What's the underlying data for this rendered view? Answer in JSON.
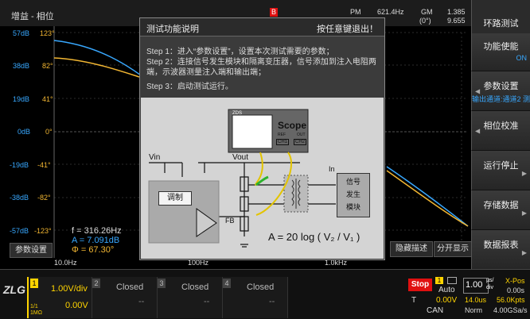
{
  "top_bar": {
    "y_label": "增益 - 相位",
    "marker": "B",
    "pm_label": "PM",
    "pm_freq": "621.4Hz",
    "gm_label": "GM",
    "gm_phase": "(0°)",
    "right_val_top": "1.385",
    "right_val_bot": "9.655",
    "title": "环路测试"
  },
  "y_axis": {
    "gain": [
      "57dB",
      "38dB",
      "19dB",
      "0dB",
      "-19dB",
      "-38dB",
      "-57dB"
    ],
    "phase": [
      "123°",
      "82°",
      "41°",
      "0°",
      "-41°",
      "-82°",
      "-123°"
    ]
  },
  "x_axis": [
    "10.0Hz",
    "100Hz",
    "1.0kHz"
  ],
  "readout": {
    "f": "f = 316.26Hz",
    "a": "A = 7.091dB",
    "phi": "Φ = 67.30°"
  },
  "param_btn": "参数设置",
  "hide_btn": "隐藏描述",
  "split_btn": "分开显示",
  "colors": {
    "gain": "#38a8ff",
    "phase": "#f2b632",
    "accent": "#ffd400",
    "stop": "#e01010"
  },
  "dialog": {
    "title": "测试功能说明",
    "exit_hint": "按任意键退出！",
    "step1": "Step 1：进入“参数设置”，设置本次测试需要的参数；",
    "step2": "Step 2：连接信号发生模块和隔离变压器，信号添加到注入电阻两端，示波器测量注入端和输出端；",
    "step3": "Step 3：启动测试运行。",
    "scope_brand": "ZDS",
    "scope_label": "Scope",
    "ref_label": "REF",
    "out_label": "OUT",
    "ch1": "CH1",
    "ch2": "CH2",
    "vin": "Vin",
    "vout": "Vout",
    "in_label": "In",
    "mod_label": "调制",
    "fb_label": "FB",
    "gen_line1": "信号",
    "gen_line2": "发生",
    "gen_line3": "模块",
    "formula": "A = 20 log ( V₂ / V₁ )"
  },
  "side_menu": [
    {
      "label": "功能使能",
      "sub": "ON"
    },
    {
      "label": "参数设置",
      "sub": "输出通道:通道2 测"
    },
    {
      "label": "相位校准",
      "sub": ""
    },
    {
      "label": "运行停止",
      "sub": ""
    },
    {
      "label": "存储数据",
      "sub": ""
    },
    {
      "label": "数据报表",
      "sub": ""
    }
  ],
  "bottom": {
    "brand": "ZLG",
    "ch1_num": "1",
    "ch1_scale": "1.00V/div",
    "ch1_offset": "0.00V",
    "ch1_imp": "1MΩ",
    "ch1_coupling": "1/1",
    "ch2_num": "2",
    "ch2_status": "Closed",
    "ch2_dash": "--",
    "ch3_num": "3",
    "ch3_status": "Closed",
    "ch3_dash": "--",
    "ch4_num": "4",
    "ch4_status": "Closed",
    "ch4_dash": "--",
    "stop": "Stop",
    "trig_src": "1",
    "trig_mode": "Auto",
    "trig_level": "0.00V",
    "trig_type": "T",
    "trig_bus": "CAN",
    "time_scale": "1.00",
    "time_unit_top": "µs/",
    "time_unit_bot": "div",
    "xpos_label": "X-Pos",
    "xpos_val": "0.00s",
    "delay": "14.0us",
    "mem": "56.0Kpts",
    "acq": "Norm",
    "rate": "4.00GSa/s"
  }
}
